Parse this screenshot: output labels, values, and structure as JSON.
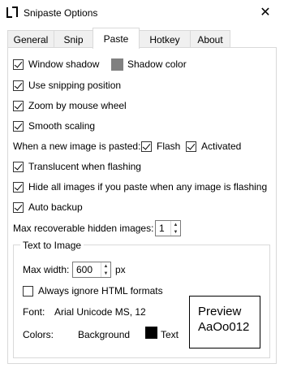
{
  "window": {
    "title": "Snipaste Options"
  },
  "tabs": [
    {
      "label": "General"
    },
    {
      "label": "Snip"
    },
    {
      "label": "Paste"
    },
    {
      "label": "Hotkey"
    },
    {
      "label": "About"
    }
  ],
  "active_tab": "Paste",
  "options": {
    "window_shadow": {
      "label": "Window shadow",
      "checked": true
    },
    "shadow_color": {
      "label": "Shadow color",
      "color": "#808080"
    },
    "use_snipping_position": {
      "label": "Use snipping position",
      "checked": true
    },
    "zoom_mouse_wheel": {
      "label": "Zoom by mouse wheel",
      "checked": true
    },
    "smooth_scaling": {
      "label": "Smooth scaling",
      "checked": true
    },
    "new_image_label": "When a new image is pasted:",
    "flash": {
      "label": "Flash",
      "checked": true
    },
    "activated": {
      "label": "Activated",
      "checked": true
    },
    "translucent_flash": {
      "label": "Translucent when flashing",
      "checked": true
    },
    "hide_all": {
      "label": "Hide all images if you paste when any image is flashing",
      "checked": true
    },
    "auto_backup": {
      "label": "Auto backup",
      "checked": true
    },
    "max_hidden": {
      "label": "Max recoverable hidden images:",
      "value": "1"
    }
  },
  "text_to_image": {
    "group_title": "Text to Image",
    "max_width_label": "Max width:",
    "max_width_value": "600",
    "max_width_unit": "px",
    "ignore_html": {
      "label": "Always ignore HTML formats",
      "checked": false
    },
    "font_label": "Font:",
    "font_value": "Arial Unicode MS, 12",
    "colors_label": "Colors:",
    "background_label": "Background",
    "text_label": "Text",
    "text_color": "#000000",
    "preview_line1": "Preview",
    "preview_line2": "AaOo012"
  }
}
